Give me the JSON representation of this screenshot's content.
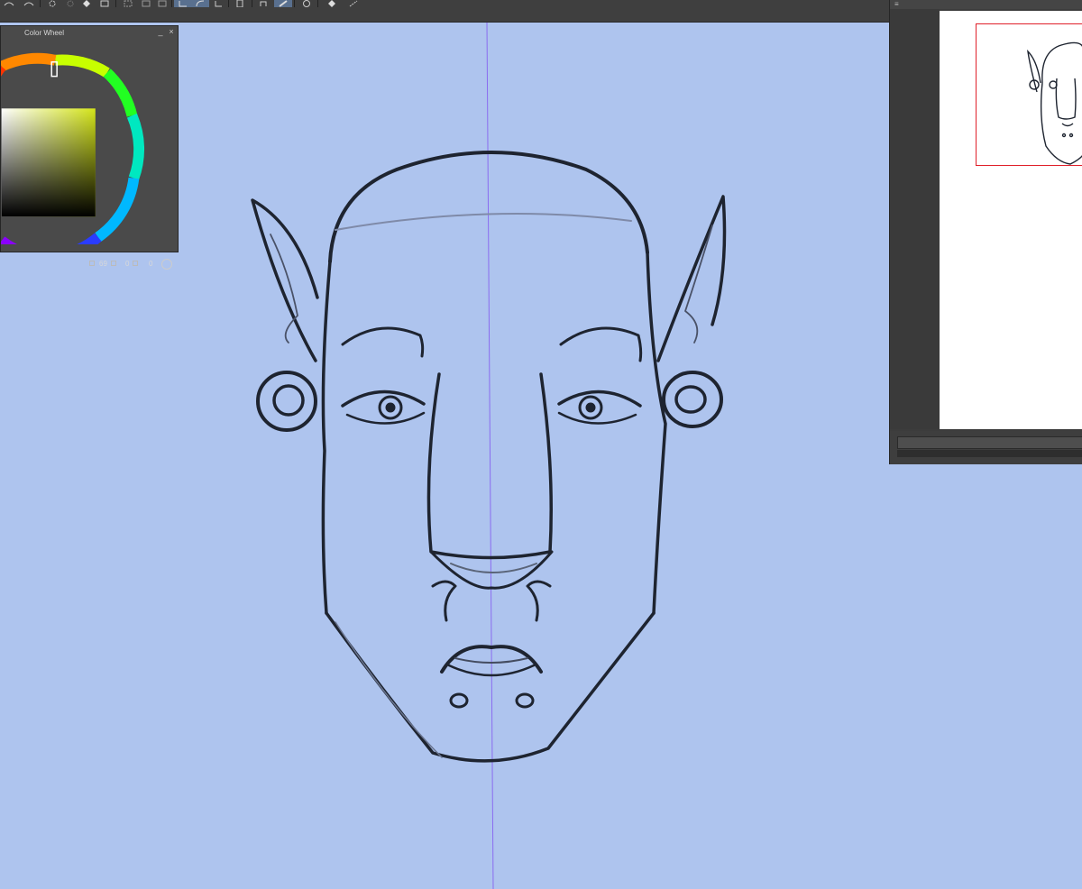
{
  "toolbar": {
    "buttons": [
      {
        "name": "undo-icon"
      },
      {
        "name": "redo-icon"
      },
      {
        "name": "loading-icon"
      },
      {
        "name": "clear-icon"
      },
      {
        "name": "fill-icon"
      },
      {
        "name": "transform-icon"
      },
      {
        "name": "select-all-icon"
      },
      {
        "name": "deselect-icon"
      },
      {
        "name": "lasso-icon"
      },
      {
        "name": "ruler-icon"
      },
      {
        "name": "snap-icon"
      },
      {
        "name": "mobile-icon"
      },
      {
        "name": "hand-icon"
      },
      {
        "name": "pen-icon"
      },
      {
        "name": "shape-icon"
      },
      {
        "name": "fill-bucket-icon"
      },
      {
        "name": "brush-icon"
      }
    ]
  },
  "color_wheel": {
    "title": "Color Wheel",
    "minimize": "_",
    "close": "×",
    "values": {
      "h": "69",
      "s": "0",
      "v": "0"
    },
    "main_color": "#d4e41a",
    "colors": {
      "panel_bg": "#4a4a4a",
      "ring_hue_marker": "#d9ff00"
    }
  },
  "navigator": {
    "viewport_color": "#e0202a"
  }
}
